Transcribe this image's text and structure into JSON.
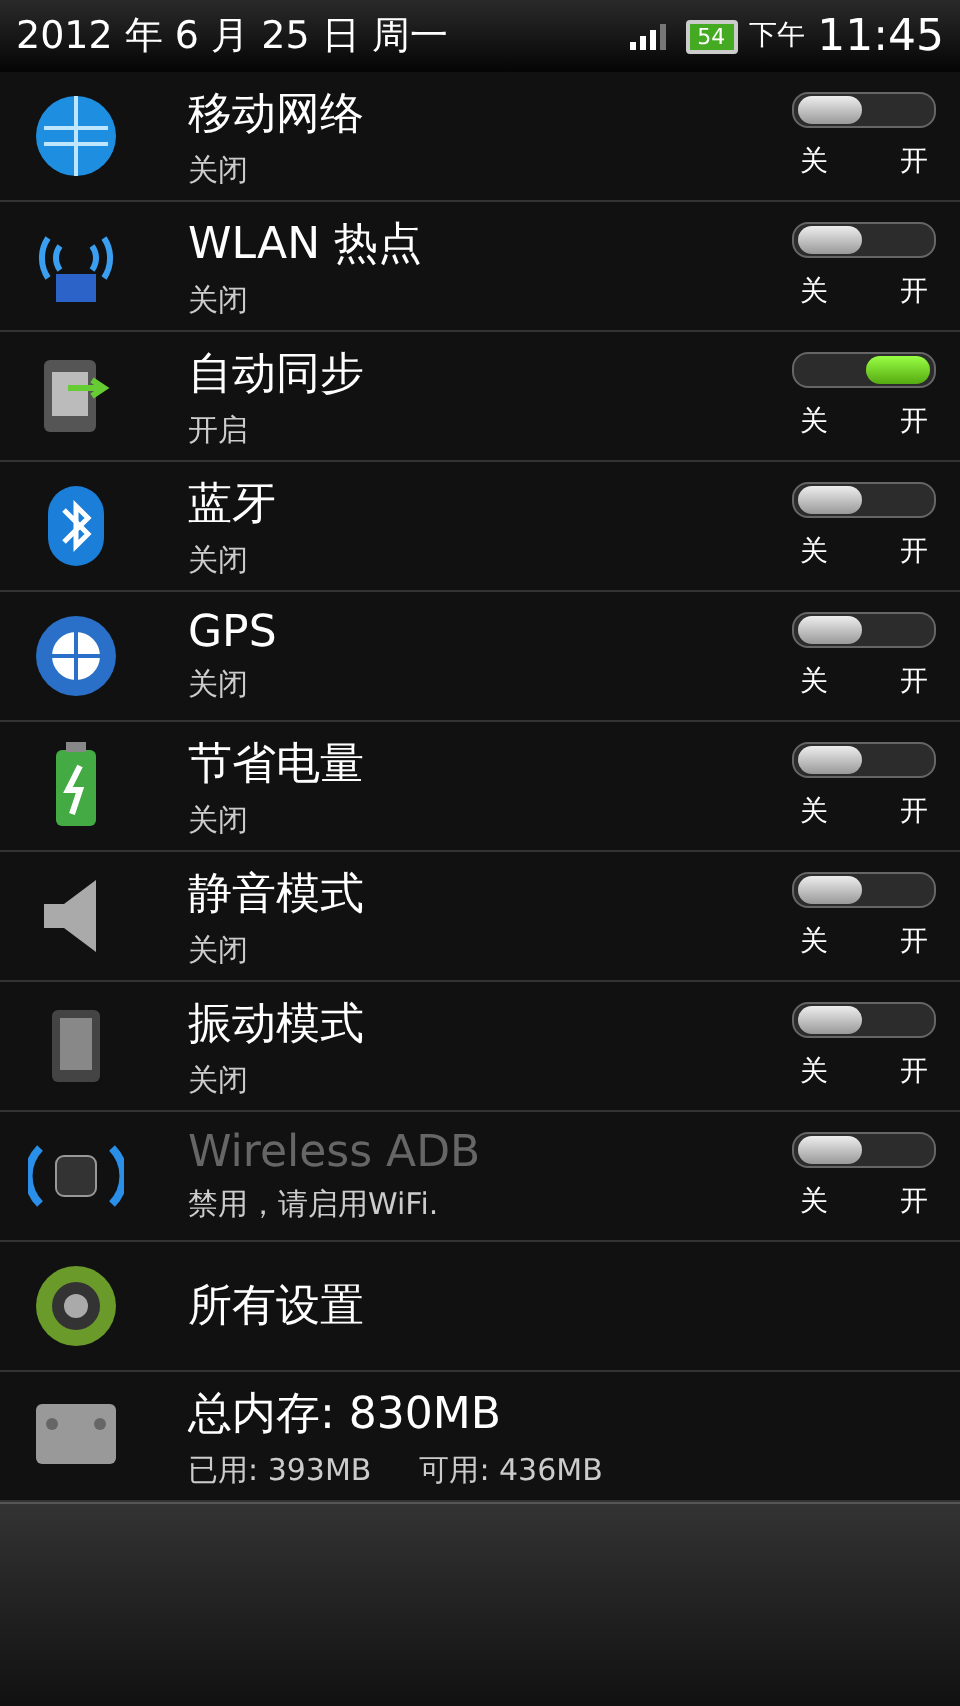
{
  "status_bar": {
    "date": "2012 年 6 月 25 日 周一",
    "battery": "54",
    "ampm": "下午",
    "time": "11:45"
  },
  "rows": [
    {
      "kind": "toggle",
      "title": "移动网络",
      "subtitle": "关闭",
      "on": false,
      "disabled": false,
      "off_label": "关",
      "on_label": "开"
    },
    {
      "kind": "toggle",
      "title": "WLAN 热点",
      "subtitle": "关闭",
      "on": false,
      "disabled": false,
      "off_label": "关",
      "on_label": "开"
    },
    {
      "kind": "toggle",
      "title": "自动同步",
      "subtitle": "开启",
      "on": true,
      "disabled": false,
      "off_label": "关",
      "on_label": "开"
    },
    {
      "kind": "toggle",
      "title": "蓝牙",
      "subtitle": "关闭",
      "on": false,
      "disabled": false,
      "off_label": "关",
      "on_label": "开"
    },
    {
      "kind": "toggle",
      "title": "GPS",
      "subtitle": "关闭",
      "on": false,
      "disabled": false,
      "off_label": "关",
      "on_label": "开"
    },
    {
      "kind": "toggle",
      "title": "节省电量",
      "subtitle": "关闭",
      "on": false,
      "disabled": false,
      "off_label": "关",
      "on_label": "开"
    },
    {
      "kind": "toggle",
      "title": "静音模式",
      "subtitle": "关闭",
      "on": false,
      "disabled": false,
      "off_label": "关",
      "on_label": "开"
    },
    {
      "kind": "toggle",
      "title": "振动模式",
      "subtitle": "关闭",
      "on": false,
      "disabled": false,
      "off_label": "关",
      "on_label": "开"
    },
    {
      "kind": "toggle",
      "title": "Wireless ADB",
      "subtitle": "禁用，请启用WiFi.",
      "on": false,
      "disabled": true,
      "off_label": "关",
      "on_label": "开"
    },
    {
      "kind": "link",
      "title": "所有设置"
    },
    {
      "kind": "memory",
      "title": "总内存: 830MB",
      "used": "已用: 393MB",
      "free": "可用: 436MB"
    }
  ]
}
